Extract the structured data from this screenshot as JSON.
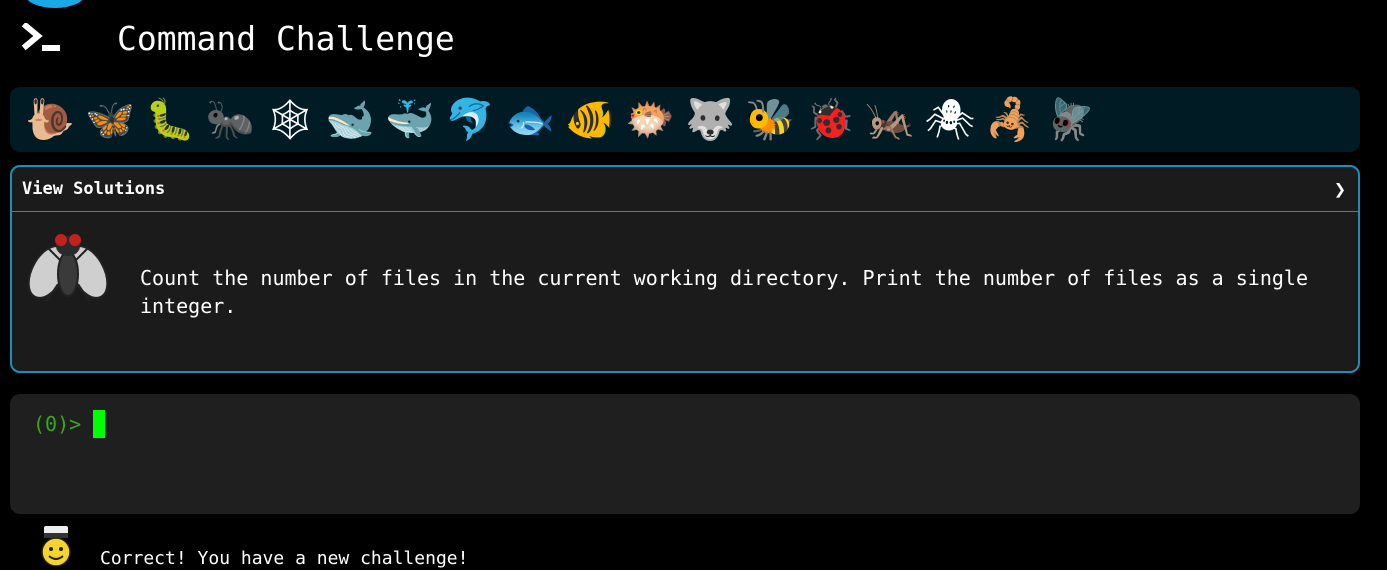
{
  "header": {
    "logo_icon": "terminal-prompt-icon",
    "title": "Command Challenge"
  },
  "bug_bar": {
    "items": [
      {
        "name": "snail",
        "glyph": "🐌"
      },
      {
        "name": "butterfly",
        "glyph": "🦋"
      },
      {
        "name": "caterpillar",
        "glyph": "🐛"
      },
      {
        "name": "ant",
        "glyph": "🐜"
      },
      {
        "name": "spider-web",
        "glyph": "🕸"
      },
      {
        "name": "whale",
        "glyph": "🐋"
      },
      {
        "name": "spouting-whale",
        "glyph": "🐳"
      },
      {
        "name": "dolphin",
        "glyph": "🐬"
      },
      {
        "name": "fish",
        "glyph": "🐟"
      },
      {
        "name": "tropical-fish",
        "glyph": "🐠"
      },
      {
        "name": "blowfish",
        "glyph": "🐡"
      },
      {
        "name": "wolf",
        "glyph": "🐺"
      },
      {
        "name": "bee",
        "glyph": "🐝"
      },
      {
        "name": "ladybug",
        "glyph": "🐞"
      },
      {
        "name": "cricket",
        "glyph": "🦗"
      },
      {
        "name": "spider",
        "glyph": "🕷"
      },
      {
        "name": "scorpion",
        "glyph": "🦂"
      },
      {
        "name": "fly",
        "glyph": "🪰"
      }
    ]
  },
  "solutions": {
    "title": "View Solutions",
    "chevron": "❯",
    "icon": "fly-icon",
    "challenge_text": "Count the number of files in the current working directory. Print the number of files as a single integer."
  },
  "terminal": {
    "prompt": "(0)>"
  },
  "status": {
    "icon": "chef-face-icon",
    "message": "Correct! You have a new challenge!"
  },
  "colors": {
    "accent": "#1b8fb8",
    "cursor": "#00ff00",
    "prompt": "#3aa81a",
    "panel": "#1b1b1b",
    "bug_bar": "#001b24"
  }
}
